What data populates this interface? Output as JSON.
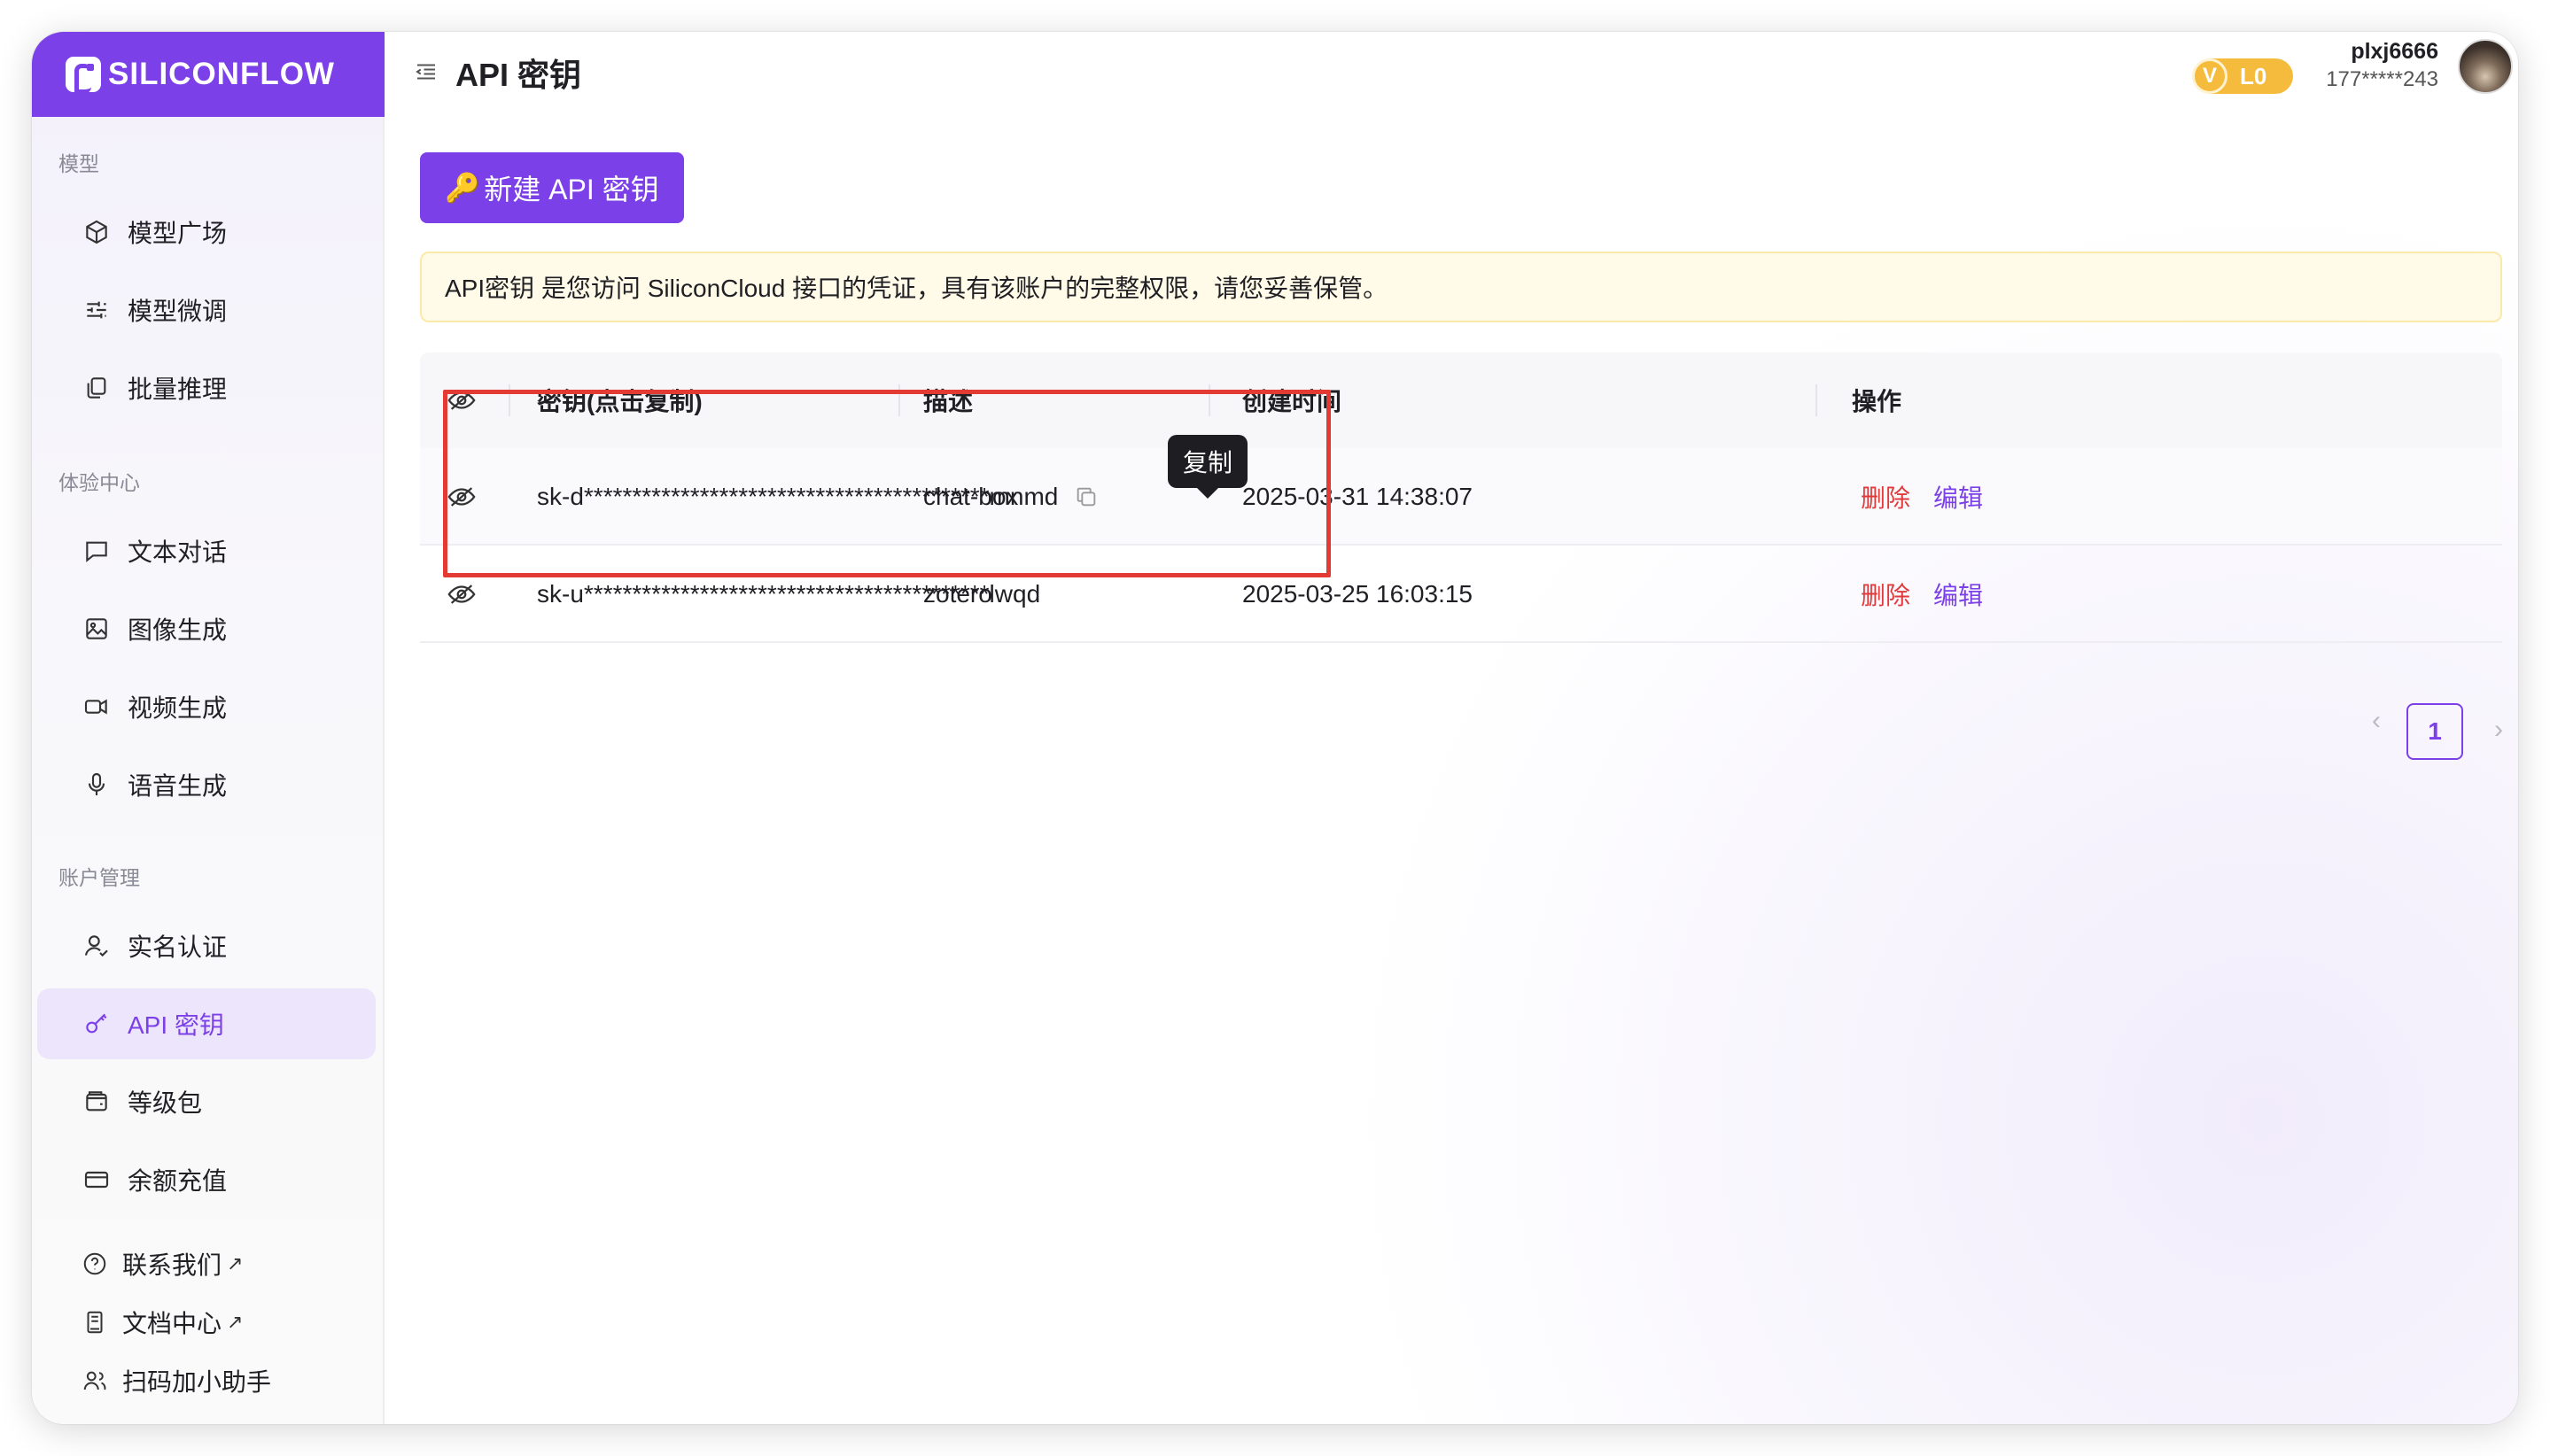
{
  "app": {
    "brand": "SILICONFLOW",
    "page_title": "API 密钥"
  },
  "user": {
    "level": "L0",
    "level_badge_letter": "V",
    "name": "plxj6666",
    "phone": "177*****243"
  },
  "sidebar": {
    "sections": [
      {
        "label": "模型"
      },
      {
        "label": "体验中心"
      },
      {
        "label": "账户管理"
      }
    ],
    "items": [
      {
        "label": "模型广场",
        "icon": "cube-icon"
      },
      {
        "label": "模型微调",
        "icon": "sliders-icon"
      },
      {
        "label": "批量推理",
        "icon": "copy-stack-icon"
      },
      {
        "label": "文本对话",
        "icon": "chat-bubble-icon"
      },
      {
        "label": "图像生成",
        "icon": "image-icon"
      },
      {
        "label": "视频生成",
        "icon": "video-camera-icon"
      },
      {
        "label": "语音生成",
        "icon": "microphone-icon"
      },
      {
        "label": "实名认证",
        "icon": "user-check-icon"
      },
      {
        "label": "API 密钥",
        "icon": "key-icon",
        "active": true
      },
      {
        "label": "等级包",
        "icon": "wallet-icon"
      },
      {
        "label": "余额充值",
        "icon": "credit-card-icon"
      }
    ],
    "external": [
      {
        "label": "联系我们",
        "icon": "help-circle-icon",
        "arrow": "↗"
      },
      {
        "label": "文档中心",
        "icon": "document-icon",
        "arrow": "↗"
      },
      {
        "label": "扫码加小助手",
        "icon": "users-icon"
      }
    ]
  },
  "toolbar": {
    "new_key_label": "新建 API 密钥",
    "new_key_emoji": "🔑"
  },
  "notice": {
    "text": "API密钥 是您访问 SiliconCloud 接口的凭证，具有该账户的完整权限，请您妥善保管。"
  },
  "table": {
    "columns": [
      "密钥(点击复制)",
      "描述",
      "创建时间",
      "操作"
    ],
    "rows": [
      {
        "key": "sk-d******************************************mnmd",
        "description": "chat-box",
        "created": "2025-03-31 14:38:07",
        "delete": "删除",
        "edit": "编辑"
      },
      {
        "key": "sk-u******************************************lwqd",
        "description": "zotero",
        "created": "2025-03-25 16:03:15",
        "delete": "删除",
        "edit": "编辑"
      }
    ]
  },
  "tooltip": {
    "text": "复制"
  },
  "pagination": {
    "current": "1",
    "prev": "‹",
    "next": "›"
  },
  "colors": {
    "brand": "#7b40e8",
    "danger": "#e23a3a",
    "highlight": "#e33a33",
    "notice_bg": "#fffbe8",
    "level_badge": "#f5bb3d"
  }
}
